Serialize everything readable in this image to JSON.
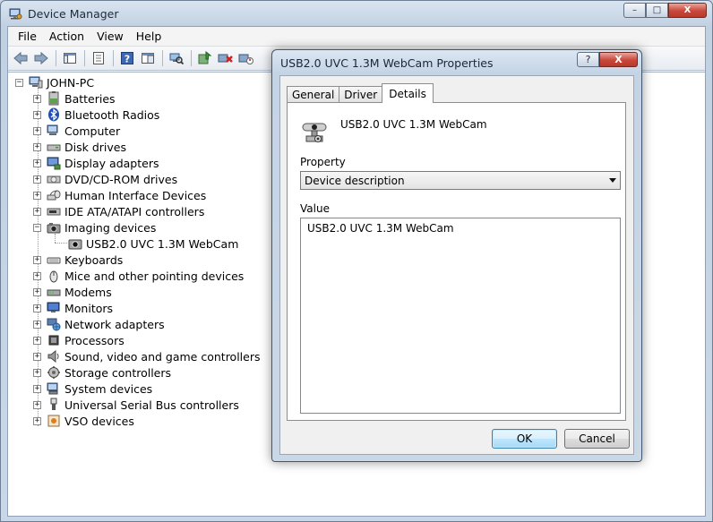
{
  "window": {
    "title": "Device Manager",
    "controls": {
      "minimize": "–",
      "maximize": "□",
      "close": "X"
    }
  },
  "menu": [
    "File",
    "Action",
    "View",
    "Help"
  ],
  "toolbar": {
    "icons": [
      "back-icon",
      "forward-icon",
      "console-tree-icon",
      "properties-icon",
      "help-icon",
      "show-hide-icon",
      "scan-hardware-icon",
      "update-driver-icon",
      "uninstall-icon",
      "disable-icon"
    ]
  },
  "tree": {
    "root": "JOHN-PC",
    "categories": [
      {
        "label": "Batteries",
        "expanded": false,
        "icon": "battery-icon"
      },
      {
        "label": "Bluetooth Radios",
        "expanded": false,
        "icon": "bluetooth-icon"
      },
      {
        "label": "Computer",
        "expanded": false,
        "icon": "computer-icon"
      },
      {
        "label": "Disk drives",
        "expanded": false,
        "icon": "disk-drive-icon"
      },
      {
        "label": "Display adapters",
        "expanded": false,
        "icon": "display-adapter-icon"
      },
      {
        "label": "DVD/CD-ROM drives",
        "expanded": false,
        "icon": "dvd-drive-icon"
      },
      {
        "label": "Human Interface Devices",
        "expanded": false,
        "icon": "hid-icon"
      },
      {
        "label": "IDE ATA/ATAPI controllers",
        "expanded": false,
        "icon": "ide-controller-icon"
      },
      {
        "label": "Imaging devices",
        "expanded": true,
        "icon": "camera-icon",
        "children": [
          "USB2.0 UVC 1.3M WebCam"
        ]
      },
      {
        "label": "Keyboards",
        "expanded": false,
        "icon": "keyboard-icon"
      },
      {
        "label": "Mice and other pointing devices",
        "expanded": false,
        "icon": "mouse-icon"
      },
      {
        "label": "Modems",
        "expanded": false,
        "icon": "modem-icon"
      },
      {
        "label": "Monitors",
        "expanded": false,
        "icon": "monitor-icon"
      },
      {
        "label": "Network adapters",
        "expanded": false,
        "icon": "network-adapter-icon"
      },
      {
        "label": "Processors",
        "expanded": false,
        "icon": "processor-icon"
      },
      {
        "label": "Sound, video and game controllers",
        "expanded": false,
        "icon": "speaker-icon"
      },
      {
        "label": "Storage controllers",
        "expanded": false,
        "icon": "storage-controller-icon"
      },
      {
        "label": "System devices",
        "expanded": false,
        "icon": "system-device-icon"
      },
      {
        "label": "Universal Serial Bus controllers",
        "expanded": false,
        "icon": "usb-icon"
      },
      {
        "label": "VSO devices",
        "expanded": false,
        "icon": "vso-device-icon"
      }
    ]
  },
  "dialog": {
    "title": "USB2.0 UVC 1.3M WebCam Properties",
    "help": "?",
    "close": "X",
    "tabs": [
      {
        "label": "General",
        "active": false
      },
      {
        "label": "Driver",
        "active": false
      },
      {
        "label": "Details",
        "active": true
      }
    ],
    "device_name": "USB2.0 UVC 1.3M WebCam",
    "property_label": "Property",
    "property_value": "Device description",
    "value_label": "Value",
    "values": [
      "USB2.0 UVC 1.3M WebCam"
    ],
    "ok": "OK",
    "cancel": "Cancel"
  }
}
